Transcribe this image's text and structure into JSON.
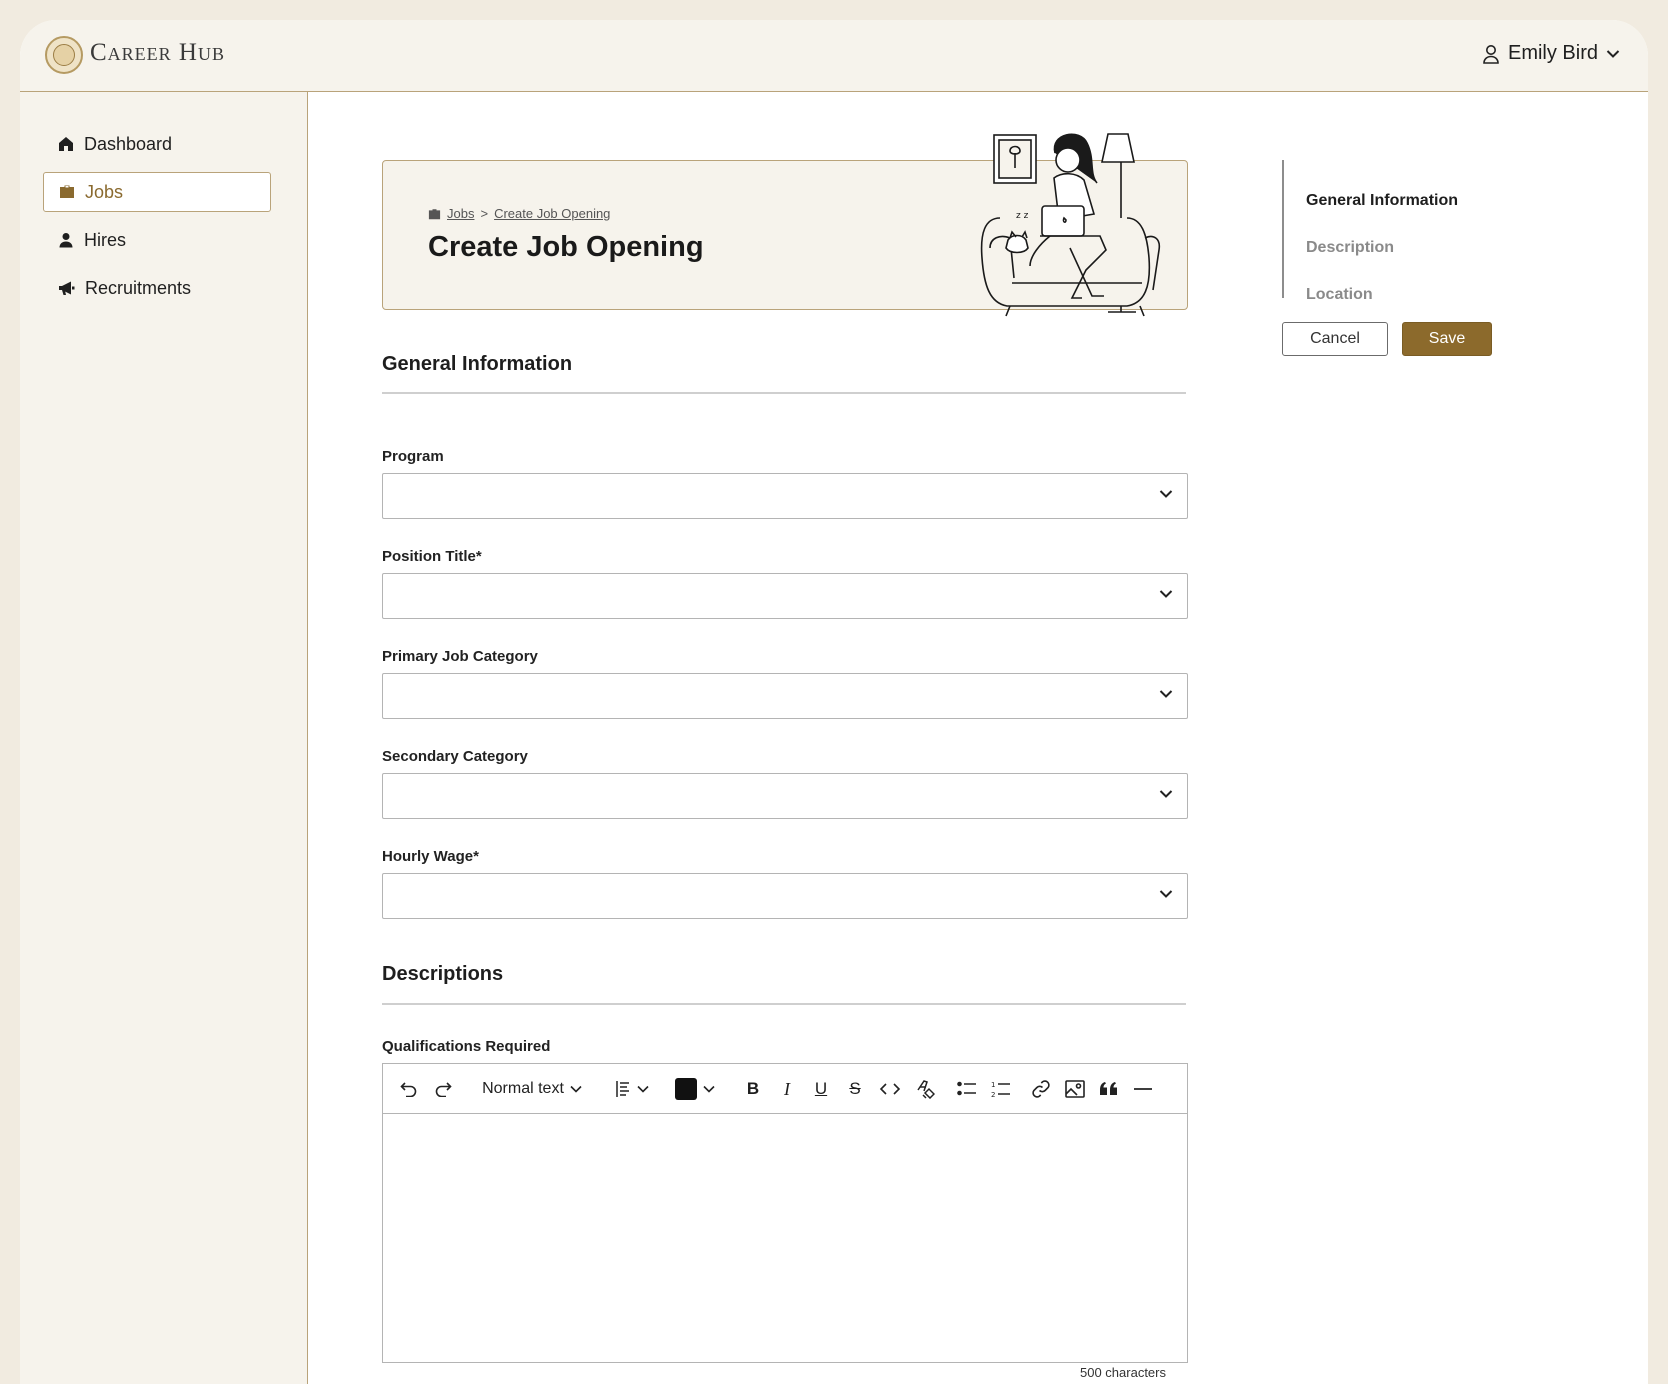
{
  "brand": {
    "name": "Career Hub"
  },
  "user": {
    "name": "Emily Bird"
  },
  "sidebar": {
    "items": [
      {
        "label": "Dashboard",
        "icon": "home-icon"
      },
      {
        "label": "Jobs",
        "icon": "briefcase-icon",
        "active": true
      },
      {
        "label": "Hires",
        "icon": "person-icon"
      },
      {
        "label": "Recruitments",
        "icon": "megaphone-icon"
      }
    ]
  },
  "hero": {
    "breadcrumb": [
      "Jobs",
      "Create Job Opening"
    ],
    "separator": ">",
    "title": "Create Job Opening"
  },
  "general": {
    "title": "General Information",
    "fields": [
      {
        "label": "Program",
        "value": ""
      },
      {
        "label": "Position Title*",
        "value": ""
      },
      {
        "label": "Primary Job Category",
        "value": ""
      },
      {
        "label": "Secondary Category",
        "value": ""
      },
      {
        "label": "Hourly Wage*",
        "value": ""
      }
    ]
  },
  "descriptions": {
    "title": "Descriptions",
    "qualifications_label": "Qualifications Required",
    "text_style": "Normal text",
    "text_color": "#111111",
    "char_count": "500 characters"
  },
  "rail": {
    "items": [
      "General Information",
      "Description",
      "Location"
    ],
    "active_index": 0
  },
  "actions": {
    "cancel": "Cancel",
    "save": "Save"
  },
  "colors": {
    "accent": "#8c6a2c",
    "border": "#b9a37a",
    "panel": "#f6f3ec"
  }
}
